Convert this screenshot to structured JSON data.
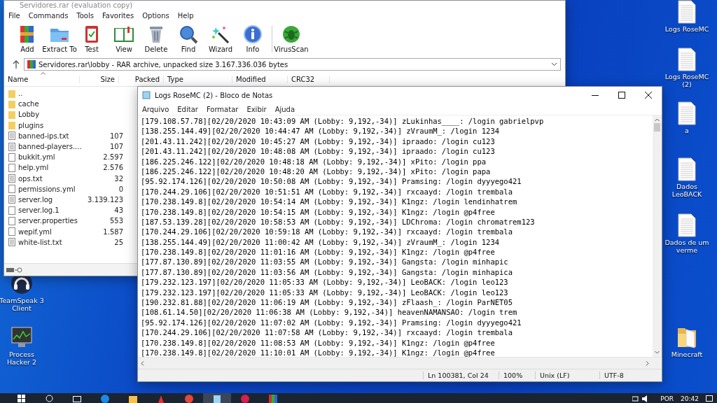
{
  "archiver": {
    "title": "Servidores.rar (evaluation copy)",
    "menu": [
      "File",
      "Commands",
      "Tools",
      "Favorites",
      "Options",
      "Help"
    ],
    "toolbar": [
      {
        "label": "Add",
        "kind": "add"
      },
      {
        "label": "Extract To",
        "kind": "extract"
      },
      {
        "label": "Test",
        "kind": "test"
      },
      {
        "label": "View",
        "kind": "view"
      },
      {
        "label": "Delete",
        "kind": "delete"
      },
      {
        "label": "Find",
        "kind": "find"
      },
      {
        "label": "Wizard",
        "kind": "wizard"
      },
      {
        "label": "Info",
        "kind": "info"
      },
      {
        "label": "VirusScan",
        "kind": "virus"
      }
    ],
    "address": "Servidores.rar\\lobby - RAR archive, unpacked size 3.167.336.036 bytes",
    "columns": [
      "Name",
      "Size",
      "Packed",
      "Type",
      "Modified",
      "CRC32"
    ],
    "files": [
      {
        "name": "..",
        "kind": "folder"
      },
      {
        "name": "cache",
        "kind": "folder"
      },
      {
        "name": "Lobby",
        "kind": "folder"
      },
      {
        "name": "plugins",
        "kind": "folder"
      },
      {
        "name": "banned-ips.txt",
        "kind": "text",
        "size": "107"
      },
      {
        "name": "banned-players....",
        "kind": "text",
        "size": "107"
      },
      {
        "name": "bukkit.yml",
        "kind": "file",
        "size": "2.597"
      },
      {
        "name": "help.yml",
        "kind": "file",
        "size": "2.576"
      },
      {
        "name": "ops.txt",
        "kind": "text",
        "size": "32"
      },
      {
        "name": "permissions.yml",
        "kind": "file",
        "size": "0"
      },
      {
        "name": "server.log",
        "kind": "text",
        "size": "3.139.123"
      },
      {
        "name": "server.log.1",
        "kind": "file",
        "size": "43"
      },
      {
        "name": "server.properties",
        "kind": "file",
        "size": "553"
      },
      {
        "name": "wepif.yml",
        "kind": "file",
        "size": "1.587"
      },
      {
        "name": "white-list.txt",
        "kind": "text",
        "size": "25"
      }
    ]
  },
  "notepad": {
    "title": "Logs RoseMC (2) - Bloco de Notas",
    "menu": [
      "Arquivo",
      "Editar",
      "Formatar",
      "Exibir",
      "Ajuda"
    ],
    "lines": [
      "[179.108.57.78][02/20/2020 10:43:09 AM (Lobby: 9,192,-34)] zLukinhas____: /login gabrielpvp",
      "[138.255.144.49][02/20/2020 10:44:47 AM (Lobby: 9,192,-34)] zVraumM_: /login 1234",
      "[201.43.11.242][02/20/2020 10:45:27 AM (Lobby: 9,192,-34)] ipraado: /login cu123",
      "[201.43.11.242][02/20/2020 10:48:08 AM (Lobby: 9,192,-34)] ipraado: /login cu123",
      "[186.225.246.122][02/20/2020 10:48:18 AM (Lobby: 9,192,-34)] xPito: /login ppa",
      "[186.225.246.122][02/20/2020 10:48:20 AM (Lobby: 9,192,-34)] xPito: /login papa",
      "[95.92.174.126][02/20/2020 10:50:08 AM (Lobby: 9,192,-34)] Pramsing: /login dyyyego421",
      "[170.244.29.106][02/20/2020 10:51:51 AM (Lobby: 9,192,-34)] rxcaayd: /login trembala",
      "[170.238.149.8][02/20/2020 10:54:14 AM (Lobby: 9,192,-34)] K1ngz: /login lendinhatrem",
      "[170.238.149.8][02/20/2020 10:54:15 AM (Lobby: 9,192,-34)] K1ngz: /login @p4free",
      "[187.53.139.28][02/20/2020 10:58:53 AM (Lobby: 9,192,-34)] LDChroma: /login chromatrem123",
      "[170.244.29.106][02/20/2020 10:59:18 AM (Lobby: 9,192,-34)] rxcaayd: /login trembala",
      "[138.255.144.49][02/20/2020 11:00:42 AM (Lobby: 9,192,-34)] zVraumM_: /login 1234",
      "[170.238.149.8][02/20/2020 11:01:16 AM (Lobby: 9,192,-34)] K1ngz: /login @p4free",
      "[177.87.130.89][02/20/2020 11:03:55 AM (Lobby: 9,192,-34)] Gangsta: /login minhapic",
      "[177.87.130.89][02/20/2020 11:03:56 AM (Lobby: 9,192,-34)] Gangsta: /login minhapica",
      "[179.232.123.197][02/20/2020 11:05:33 AM (Lobby: 9,192,-34)] LeoBACK: /login leo123",
      "[179.232.123.197][02/20/2020 11:05:33 AM (Lobby: 9,192,-34)] LeoBACK: /login leo123",
      "[190.232.81.88][02/20/2020 11:06:19 AM (Lobby: 9,192,-34)] zFlaash_: /login ParNET05",
      "[108.61.14.50][02/20/2020 11:06:38 AM (Lobby: 9,192,-34)] heavenNAMANSAO: /login trem",
      "[95.92.174.126][02/20/2020 11:07:02 AM (Lobby: 9,192,-34)] Pramsing: /login dyyyego421",
      "[170.244.29.106][02/20/2020 11:07:58 AM (Lobby: 9,192,-34)] rxcaayd: /login trembala",
      "[170.238.149.8][02/20/2020 11:08:53 AM (Lobby: 9,192,-34)] K1ngz: /login @p4free",
      "[170.238.149.8][02/20/2020 11:10:01 AM (Lobby: 9,192,-34)] K1ngz: /login @p4free"
    ],
    "status": {
      "position": "Ln 100381, Col 24",
      "zoom": "100%",
      "line_ending": "Unix (LF)",
      "encoding": "UTF-8"
    }
  },
  "desktop_icons": [
    {
      "label": "TeamSpeak 3 Client",
      "kind": "headset"
    },
    {
      "label": "Process Hacker 2",
      "kind": "monitor"
    },
    {
      "label": "Logs RoseMC",
      "kind": "document"
    },
    {
      "label": "Logs RoseMC (2)",
      "kind": "document"
    },
    {
      "label": "a",
      "kind": "document"
    },
    {
      "label": "Dados LeoBACK",
      "kind": "document"
    },
    {
      "label": "Dados de um verme",
      "kind": "document"
    },
    {
      "label": "Minecraft",
      "kind": "folder"
    }
  ],
  "taskbar": {
    "language": "POR",
    "time": "20:42"
  }
}
